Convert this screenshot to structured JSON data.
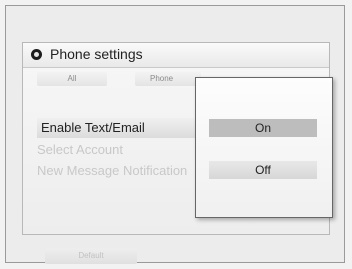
{
  "header": {
    "title": "Phone settings",
    "icon": "settings-dot-icon"
  },
  "tabs": [
    {
      "label": "All"
    },
    {
      "label": "Phone"
    }
  ],
  "menu": {
    "items": [
      {
        "label": "Enable Text/Email",
        "state": "selected"
      },
      {
        "label": "Select Account",
        "state": "disabled"
      },
      {
        "label": "New Message Notification",
        "state": "disabled"
      }
    ]
  },
  "bottom_button": {
    "label": "Default"
  },
  "popup": {
    "options": [
      {
        "label": "On",
        "state": "highlighted"
      },
      {
        "label": "Off",
        "state": "normal"
      }
    ]
  }
}
